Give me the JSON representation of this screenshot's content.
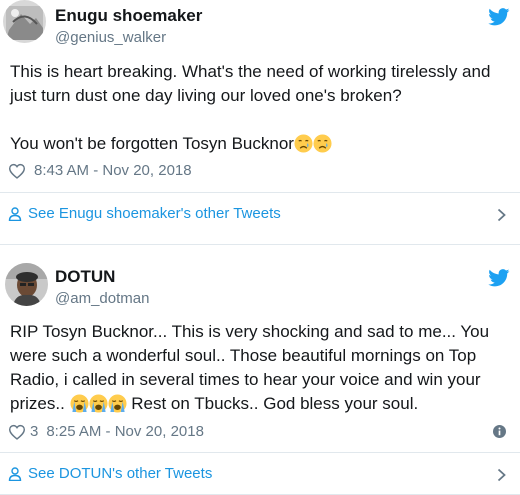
{
  "tweets": [
    {
      "author_name": "Enugu shoemaker",
      "author_handle": "@genius_walker",
      "text_line1": "This is heart breaking. What's the need of working tirelessly and just turn dust one day living our loved one's broken?",
      "text_line2": "You won't be forgotten Tosyn Bucknor",
      "emojis": [
        "crying-face",
        "crying-face"
      ],
      "like_count": "",
      "timestamp": "8:43 AM - Nov 20, 2018",
      "other_tweets_label": "See Enugu shoemaker's other Tweets"
    },
    {
      "author_name": "DOTUN",
      "author_handle": "@am_dotman",
      "text_part1": "RIP Tosyn Bucknor... This is very shocking and sad to me... You were such a wonderful soul.. Those beautiful mornings on Top Radio, i called in several times to hear your voice and win your prizes.. ",
      "text_part2": " Rest on Tbucks.. God bless your soul.",
      "emojis": [
        "loudly-crying-face",
        "loudly-crying-face",
        "loudly-crying-face"
      ],
      "like_count": "3",
      "timestamp": "8:25 AM - Nov 20, 2018",
      "other_tweets_label": "See DOTUN's other Tweets"
    }
  ],
  "colors": {
    "text": "#14171a",
    "secondary": "#657786",
    "link": "#1b95e0",
    "twitter_blue": "#1da1f2",
    "border": "#e1e8ed"
  }
}
